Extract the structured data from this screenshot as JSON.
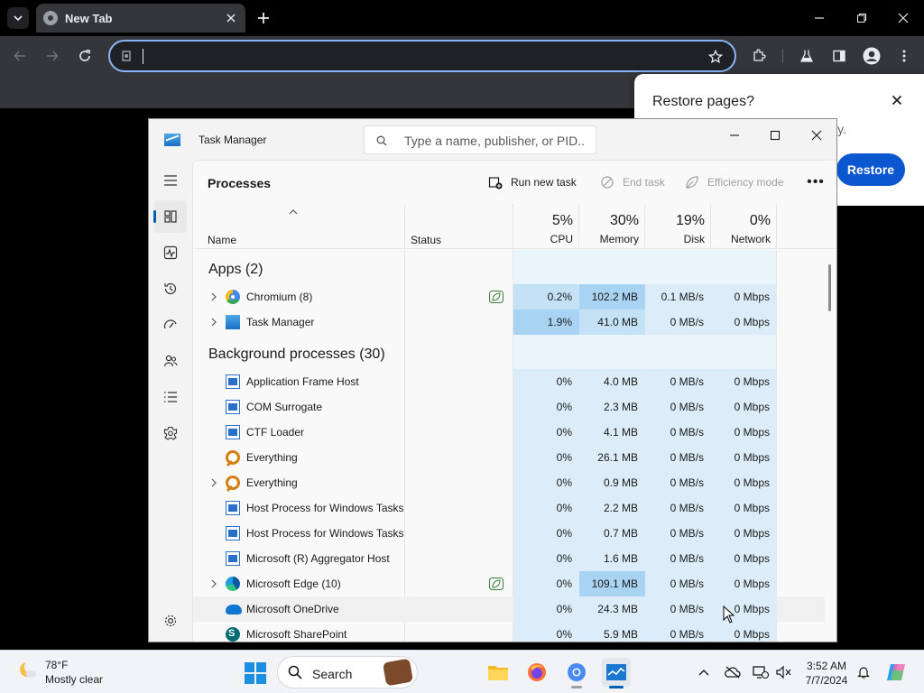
{
  "browser": {
    "tab_title": "New Tab",
    "omnibox_value": "",
    "icons": [
      "tab-search-icon",
      "close-icon",
      "plus-icon",
      "minimize-icon",
      "maximize-icon",
      "close-icon",
      "back-icon",
      "forward-icon",
      "reload-icon",
      "bookmark-star-icon",
      "extensions-icon",
      "labs-flask-icon",
      "side-panel-icon",
      "profile-icon",
      "menu-kebab-icon"
    ],
    "restore_popup": {
      "title": "Restore pages?",
      "body_fragment": "ly.",
      "button_label": "Restore"
    }
  },
  "task_manager": {
    "title": "Task Manager",
    "search_placeholder": "Type a name, publisher, or PID...",
    "page_title": "Processes",
    "actions": {
      "run_new_task": "Run new task",
      "end_task": "End task",
      "efficiency_mode": "Efficiency mode"
    },
    "columns": {
      "name": "Name",
      "status": "Status",
      "cpu": {
        "percent": "5%",
        "label": "CPU"
      },
      "memory": {
        "percent": "30%",
        "label": "Memory"
      },
      "disk": {
        "percent": "19%",
        "label": "Disk"
      },
      "network": {
        "percent": "0%",
        "label": "Network"
      }
    },
    "groups": {
      "apps": "Apps (2)",
      "background": "Background processes (30)"
    },
    "rows": [
      {
        "name": "Chromium (8)",
        "cpu": "0.2%",
        "memory": "102.2 MB",
        "disk": "0.1 MB/s",
        "network": "0 Mbps",
        "icon": "chromium-icon"
      },
      {
        "name": "Task Manager",
        "cpu": "1.9%",
        "memory": "41.0 MB",
        "disk": "0 MB/s",
        "network": "0 Mbps",
        "icon": "task-manager-icon"
      },
      {
        "name": "Application Frame Host",
        "cpu": "0%",
        "memory": "4.0 MB",
        "disk": "0 MB/s",
        "network": "0 Mbps",
        "icon": "app-frame-icon"
      },
      {
        "name": "COM Surrogate",
        "cpu": "0%",
        "memory": "2.3 MB",
        "disk": "0 MB/s",
        "network": "0 Mbps",
        "icon": "app-frame-icon"
      },
      {
        "name": "CTF Loader",
        "cpu": "0%",
        "memory": "4.1 MB",
        "disk": "0 MB/s",
        "network": "0 Mbps",
        "icon": "app-frame-icon"
      },
      {
        "name": "Everything",
        "cpu": "0%",
        "memory": "26.1 MB",
        "disk": "0 MB/s",
        "network": "0 Mbps",
        "icon": "everything-icon"
      },
      {
        "name": "Everything",
        "cpu": "0%",
        "memory": "0.9 MB",
        "disk": "0 MB/s",
        "network": "0 Mbps",
        "icon": "everything-icon"
      },
      {
        "name": "Host Process for Windows Tasks",
        "cpu": "0%",
        "memory": "2.2 MB",
        "disk": "0 MB/s",
        "network": "0 Mbps",
        "icon": "app-frame-icon"
      },
      {
        "name": "Host Process for Windows Tasks",
        "cpu": "0%",
        "memory": "0.7 MB",
        "disk": "0 MB/s",
        "network": "0 Mbps",
        "icon": "app-frame-icon"
      },
      {
        "name": "Microsoft (R) Aggregator Host",
        "cpu": "0%",
        "memory": "1.6 MB",
        "disk": "0 MB/s",
        "network": "0 Mbps",
        "icon": "app-frame-icon"
      },
      {
        "name": "Microsoft Edge (10)",
        "cpu": "0%",
        "memory": "109.1 MB",
        "disk": "0 MB/s",
        "network": "0 Mbps",
        "icon": "edge-icon"
      },
      {
        "name": "Microsoft OneDrive",
        "cpu": "0%",
        "memory": "24.3 MB",
        "disk": "0 MB/s",
        "network": "0 Mbps",
        "icon": "onedrive-icon"
      },
      {
        "name": "Microsoft SharePoint",
        "cpu": "0%",
        "memory": "5.9 MB",
        "disk": "0 MB/s",
        "network": "0 Mbps",
        "icon": "sharepoint-icon"
      }
    ]
  },
  "taskbar": {
    "weather_temp": "78°F",
    "weather_desc": "Mostly clear",
    "search_label": "Search",
    "time": "3:52 AM",
    "date": "7/7/2024"
  },
  "colors": {
    "accent": "#005fb8",
    "heat_low": "#dcedf9",
    "heat_mid": "#c4e1f6",
    "heat_high": "#a8d3f2",
    "restore_button": "#0b57d0"
  }
}
